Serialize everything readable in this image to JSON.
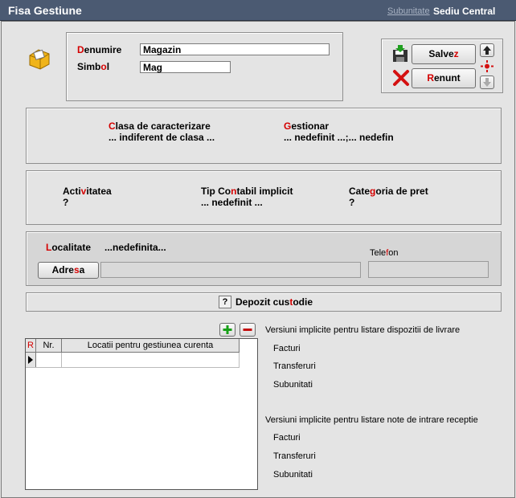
{
  "window": {
    "title": "Fisa Gestiune",
    "subunitate_label": "Subunitate",
    "subunitate_value": "Sediu Central"
  },
  "header": {
    "denumire": {
      "before": "",
      "hot": "D",
      "after": "enumire",
      "value": "Magazin"
    },
    "simbol": {
      "before": "Simb",
      "hot": "o",
      "after": "l",
      "value": "Mag"
    }
  },
  "toolbar": {
    "save": {
      "before": "Salve",
      "hot": "z",
      "after": ""
    },
    "cancel": {
      "before": "",
      "hot": "R",
      "after": "enunt"
    }
  },
  "section1": {
    "clasa": {
      "before": "",
      "hot": "C",
      "after": "lasa de caracterizare",
      "value": "... indiferent de clasa ..."
    },
    "gestionar": {
      "before": "",
      "hot": "G",
      "after": "estionar",
      "value": "... nedefinit ...;... nedefin"
    }
  },
  "section2": {
    "activitatea": {
      "before": "Acti",
      "hot": "v",
      "after": "itatea",
      "value": "?"
    },
    "tip_contabil": {
      "before": "Tip Co",
      "hot": "n",
      "after": "tabil implicit",
      "value": "... nedefinit ..."
    },
    "categoria": {
      "before": "Cate",
      "hot": "g",
      "after": "oria de pret",
      "value": "?"
    }
  },
  "section3": {
    "localitate": {
      "before": "",
      "hot": "L",
      "after": "ocalitate",
      "value": "...nedefinita..."
    },
    "adresa": {
      "before": "Adre",
      "hot": "s",
      "after": "a",
      "value": ""
    },
    "telefon": {
      "before": "Tele",
      "hot": "f",
      "after": "on",
      "value": ""
    }
  },
  "depozit": {
    "icon": "?",
    "before": "Depozit cus",
    "hot": "t",
    "after": "odie"
  },
  "grid": {
    "marker": "R",
    "columns": [
      "Nr.",
      "Locatii pentru gestiunea curenta"
    ],
    "rows": [
      {
        "nr": "",
        "locatie": ""
      }
    ]
  },
  "versions_livrare": {
    "title": "Versiuni implicite pentru listare dispozitii de livrare",
    "items": [
      "Facturi",
      "Transferuri",
      "Subunitati"
    ]
  },
  "versions_receptie": {
    "title": "Versiuni implicite pentru listare note de intrare receptie",
    "items": [
      "Facturi",
      "Transferuri",
      "Subunitati"
    ]
  }
}
